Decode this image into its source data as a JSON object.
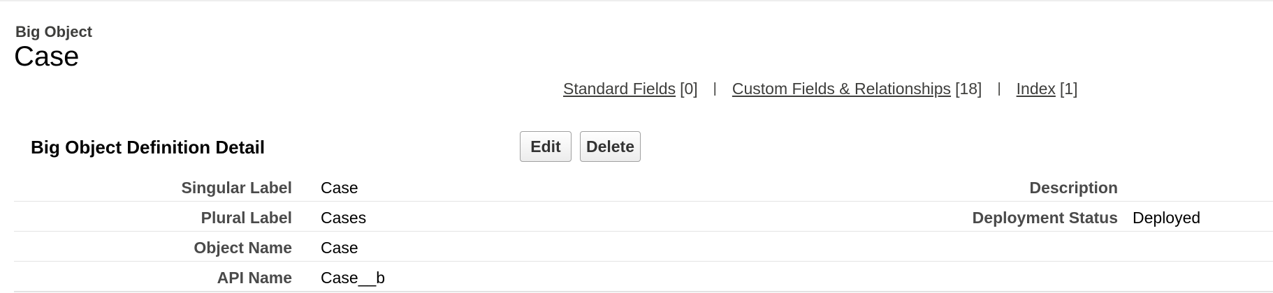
{
  "header": {
    "pre_title": "Big Object",
    "title": "Case"
  },
  "related_links": [
    {
      "label": "Standard Fields",
      "count": "[0]"
    },
    {
      "label": "Custom Fields & Relationships",
      "count": "[18]"
    },
    {
      "label": "Index",
      "count": "[1]"
    }
  ],
  "separator": "|",
  "detail": {
    "section_title": "Big Object Definition Detail",
    "edit_label": "Edit",
    "delete_label": "Delete",
    "rows": [
      {
        "label": "Singular Label",
        "value": "Case",
        "label2": "Description",
        "value2": ""
      },
      {
        "label": "Plural Label",
        "value": "Cases",
        "label2": "Deployment Status",
        "value2": "Deployed"
      },
      {
        "label": "Object Name",
        "value": "Case",
        "label2": "",
        "value2": ""
      },
      {
        "label": "API Name",
        "value": "Case__b",
        "label2": "",
        "value2": ""
      }
    ]
  }
}
